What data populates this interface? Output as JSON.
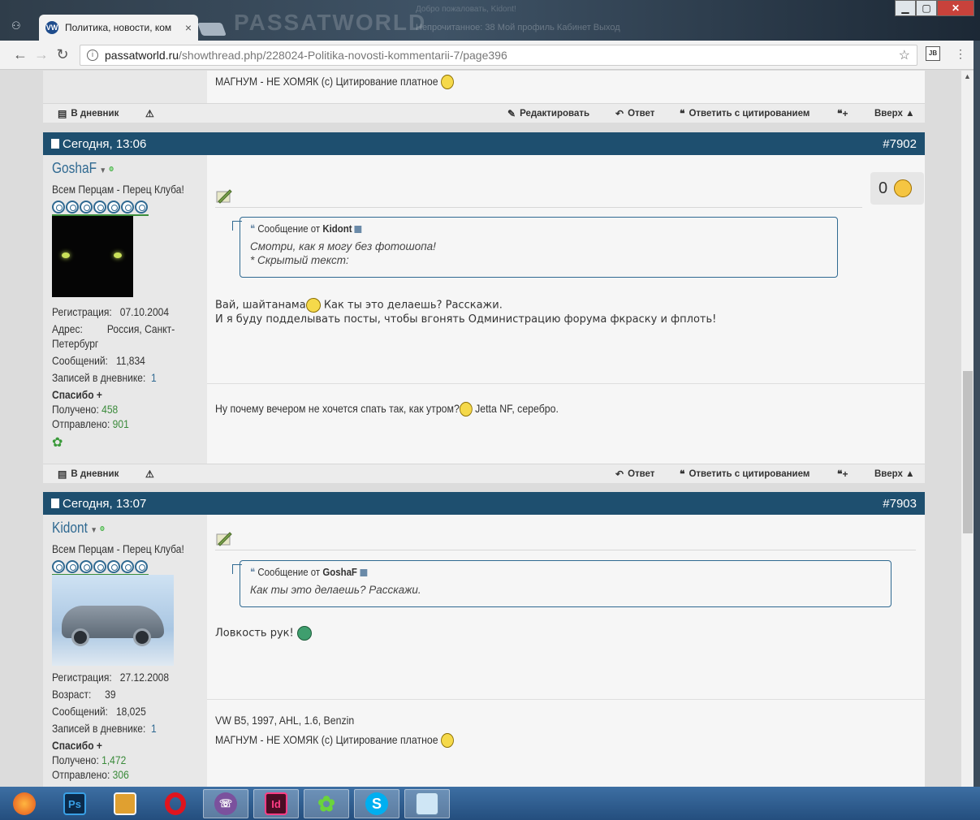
{
  "browser": {
    "tab_title": "Политика, новости, ком",
    "close_tab": "×",
    "url_domain": "passatworld.ru",
    "url_path": "/showthread.php/228024-Politika-novosti-kommentarii-7/page396",
    "ext_label": "JB",
    "bg_logo": "PASSATWORLD",
    "bg_nav": "Непрочитанное: 38     Мой профиль   Кабинет   Выход",
    "bg_greeting": "Добро пожаловать, Kidont!"
  },
  "prev_post": {
    "signature": "МАГНУМ - НЕ ХОМЯК (с) Цитирование платное"
  },
  "action_bar": {
    "diary": "В дневник",
    "edit": "Редактировать",
    "reply": "Ответ",
    "reply_quote": "Ответить с цитированием",
    "up": "Вверх ▲"
  },
  "posts": [
    {
      "date": "Сегодня, 13:06",
      "number": "#7902",
      "user": "GoshaF",
      "user_title": "Всем Перцам - Перец Клуба!",
      "reg_label": "Регистрация:",
      "reg_value": "07.10.2004",
      "addr_label": "Адрес:",
      "addr_value_1": "Россия, Санкт-",
      "addr_value_2": "Петербург",
      "msg_label": "Сообщений:",
      "msg_value": "11,834",
      "diary_label": "Записей в дневнике:",
      "diary_value": "1",
      "thanks": "Спасибо +",
      "received_label": "Получено:",
      "received_value": "458",
      "sent_label": "Отправлено:",
      "sent_value": "901",
      "likes": "0",
      "quote_header": "Сообщение от",
      "quote_author": "Kidont",
      "quote_line_1": "Смотри, как я могу без фотошопа!",
      "quote_line_2": "* Скрытый текст:",
      "body_line_1a": "Вай, шайтанама",
      "body_line_1b": " Как ты это делаешь? Расскажи.",
      "body_line_2": "И я буду подделывать посты, чтобы вгонять Одминистрацию форума фкраску и фплоть!",
      "signature_a": "Ну почему вечером не хочется спать так, как утром?",
      "signature_b": " Jetta NF, серебро."
    },
    {
      "date": "Сегодня, 13:07",
      "number": "#7903",
      "user": "Kidont",
      "user_title": "Всем Перцам - Перец Клуба!",
      "reg_label": "Регистрация:",
      "reg_value": "27.12.2008",
      "age_label": "Возраст:",
      "age_value": "39",
      "msg_label": "Сообщений:",
      "msg_value": "18,025",
      "diary_label": "Записей в дневнике:",
      "diary_value": "1",
      "thanks": "Спасибо +",
      "received_label": "Получено:",
      "received_value": "1,472",
      "sent_label": "Отправлено:",
      "sent_value": "306",
      "quote_header": "Сообщение от",
      "quote_author": "GoshaF",
      "quote_line_1": "Как ты это делаешь? Расскажи.",
      "body_line_1": "Ловкость рук! ",
      "signature_1": "VW B5, 1997, AHL, 1.6, Benzin",
      "signature_2": "МАГНУМ - НЕ ХОМЯК (с) Цитирование платное"
    }
  ],
  "taskbar": {
    "apps": [
      "firefox-icon",
      "photoshop-icon",
      "image-viewer-icon",
      "opera-icon",
      "viber-icon",
      "indesign-icon",
      "icq-icon",
      "skype-icon",
      "notepad-icon"
    ],
    "ps_label": "Ps",
    "id_label": "Id"
  },
  "colors": {
    "post_header": "#1e4f6f",
    "username": "#2f6991",
    "green_value": "#3a8a3a"
  }
}
